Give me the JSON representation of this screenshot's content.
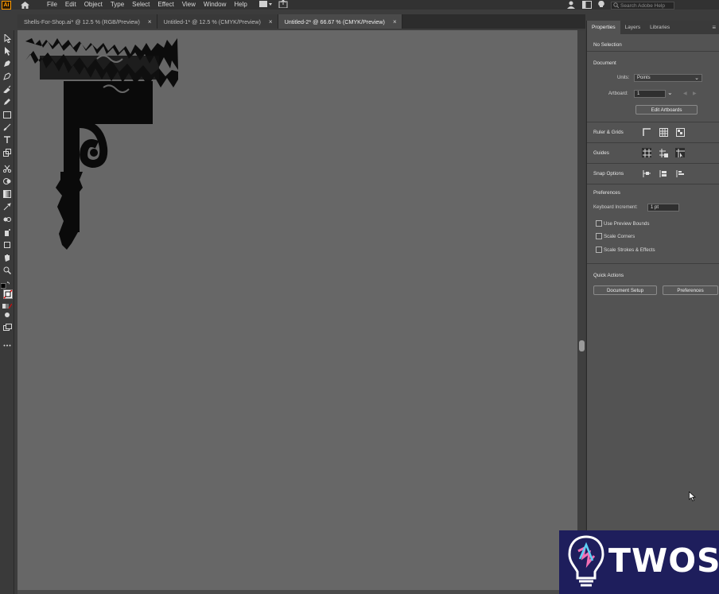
{
  "app": {
    "logo_text": "Ai"
  },
  "menu": {
    "items": [
      "File",
      "Edit",
      "Object",
      "Type",
      "Select",
      "Effect",
      "View",
      "Window",
      "Help"
    ]
  },
  "search": {
    "placeholder": "Search Adobe Help"
  },
  "tabs": [
    {
      "label": "Shells-For-Shop.ai* @ 12.5 % (RGB/Preview)",
      "active": false
    },
    {
      "label": "Untitled-1* @ 12.5 % (CMYK/Preview)",
      "active": false
    },
    {
      "label": "Untitled-2* @ 66.67 % (CMYK/Preview)",
      "active": true
    }
  ],
  "panel": {
    "tabs": [
      "Properties",
      "Layers",
      "Libraries"
    ],
    "selection_status": "No Selection",
    "document": {
      "title": "Document",
      "units_label": "Units:",
      "units_value": "Points",
      "artboard_label": "Artboard:",
      "artboard_value": "1",
      "edit_artboards": "Edit Artboards"
    },
    "ruler_grids": {
      "title": "Ruler & Grids"
    },
    "guides": {
      "title": "Guides"
    },
    "snap_options": {
      "title": "Snap Options"
    },
    "preferences": {
      "title": "Preferences",
      "keyboard_increment_label": "Keyboard Increment:",
      "keyboard_increment_value": "1 pt",
      "use_preview_bounds": "Use Preview Bounds",
      "scale_corners": "Scale Corners",
      "scale_strokes": "Scale Strokes & Effects"
    },
    "quick_actions": {
      "title": "Quick Actions",
      "document_setup": "Document Setup",
      "preferences": "Preferences"
    }
  },
  "watermark": {
    "text": "TWOS"
  },
  "colors": {
    "canvas": "#676767",
    "panel": "#535353",
    "accent_logo": "#ff9a00",
    "watermark_bg": "#1e1e5c"
  }
}
